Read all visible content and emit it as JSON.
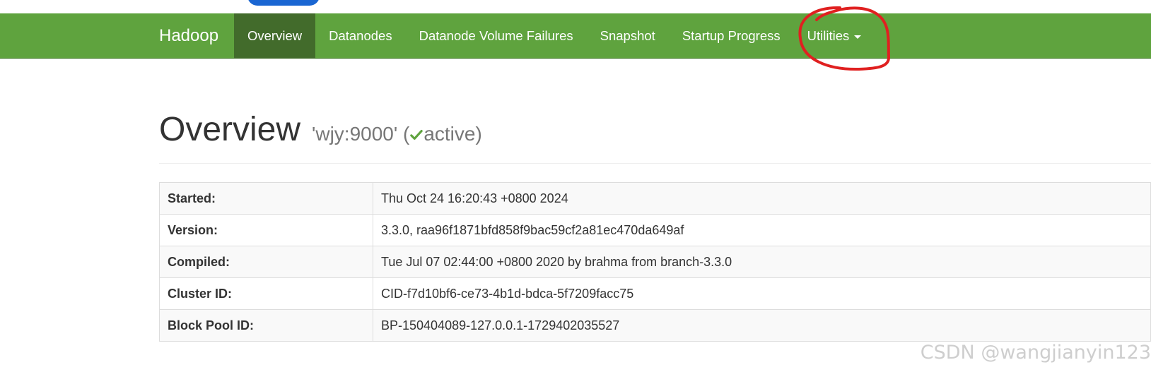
{
  "navbar": {
    "brand": "Hadoop",
    "items": [
      {
        "label": "Overview",
        "active": true
      },
      {
        "label": "Datanodes",
        "active": false
      },
      {
        "label": "Datanode Volume Failures",
        "active": false
      },
      {
        "label": "Snapshot",
        "active": false
      },
      {
        "label": "Startup Progress",
        "active": false
      },
      {
        "label": "Utilities",
        "active": false,
        "dropdown": true
      }
    ],
    "colors": {
      "background": "#5fa33e",
      "active": "#426b2b"
    }
  },
  "header": {
    "title": "Overview",
    "address": "'wjy:9000'",
    "status_open": "(",
    "status_icon": "check-icon",
    "status_text": "active",
    "status_close": ")",
    "status_color": "#5fa33e"
  },
  "info_table": [
    {
      "label": "Started:",
      "value": "Thu Oct 24 16:20:43 +0800 2024"
    },
    {
      "label": "Version:",
      "value": "3.3.0, raa96f1871bfd858f9bac59cf2a81ec470da649af"
    },
    {
      "label": "Compiled:",
      "value": "Tue Jul 07 02:44:00 +0800 2020 by brahma from branch-3.3.0"
    },
    {
      "label": "Cluster ID:",
      "value": "CID-f7d10bf6-ce73-4b1d-bdca-5f7209facc75"
    },
    {
      "label": "Block Pool ID:",
      "value": "BP-150404089-127.0.0.1-1729402035527"
    }
  ],
  "annotation": {
    "color": "#e02020",
    "shape": "circle around Utilities"
  },
  "watermark": "CSDN @wangjianyin123"
}
